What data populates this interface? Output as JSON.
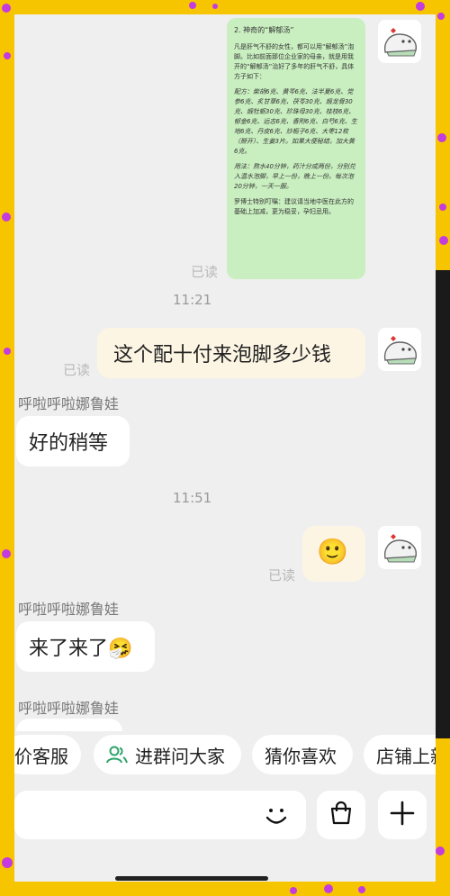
{
  "doc_message": {
    "title": "2. 神奇的“解郁汤”",
    "intro": "凡是肝气不舒的女性，都可以用“解郁汤”泡脚。比如前面那位企业家的母亲，就是用我开的“解郁汤”治好了多年的肝气不舒，具体方子如下：",
    "formula": "配方：柴胡6克、黄芩6克、法半夏6克、党参6克、炙甘草6克、茯苓30克、煅龙骨30克、煅牡蛎30克、珍珠母30克、桂枝6克、郁金6克、远志6克、香附6克、白芍6克、生地6克、丹皮6克、炒栀子6克、大枣12枚（掰开）、生姜3片。如果大便秘结，加大黄6克。",
    "usage": "用法：熬水40分钟，药汁分成两份，分别兑入温水泡脚，早上一份，晚上一份。每次泡20分钟，一天一服。",
    "note": "罗博士特别叮嘱：建议请当地中医在此方的基础上加减，更为稳妥，孕妇忌用。"
  },
  "messages": {
    "read_1": "已读",
    "time_1": "11:21",
    "out_1": "这个配十付来泡脚多少钱",
    "read_2": "已读",
    "sender_1": "呼啦呼啦娜鲁娃",
    "in_1": "好的稍等",
    "time_2": "11:51",
    "out_2_emoji": "🙂",
    "read_3": "已读",
    "sender_2": "呼啦呼啦娜鲁娃",
    "in_2": "来了来了🤧",
    "sender_3": "呼啦呼啦娜鲁娃"
  },
  "quick_actions": {
    "chip_1": "价客服",
    "chip_2": "进群问大家",
    "chip_3": "猜你喜欢",
    "chip_4": "店铺上新"
  },
  "toolbar": {
    "input_value": "",
    "icons": [
      "smile-icon",
      "shopping-bag-icon",
      "plus-icon"
    ]
  }
}
